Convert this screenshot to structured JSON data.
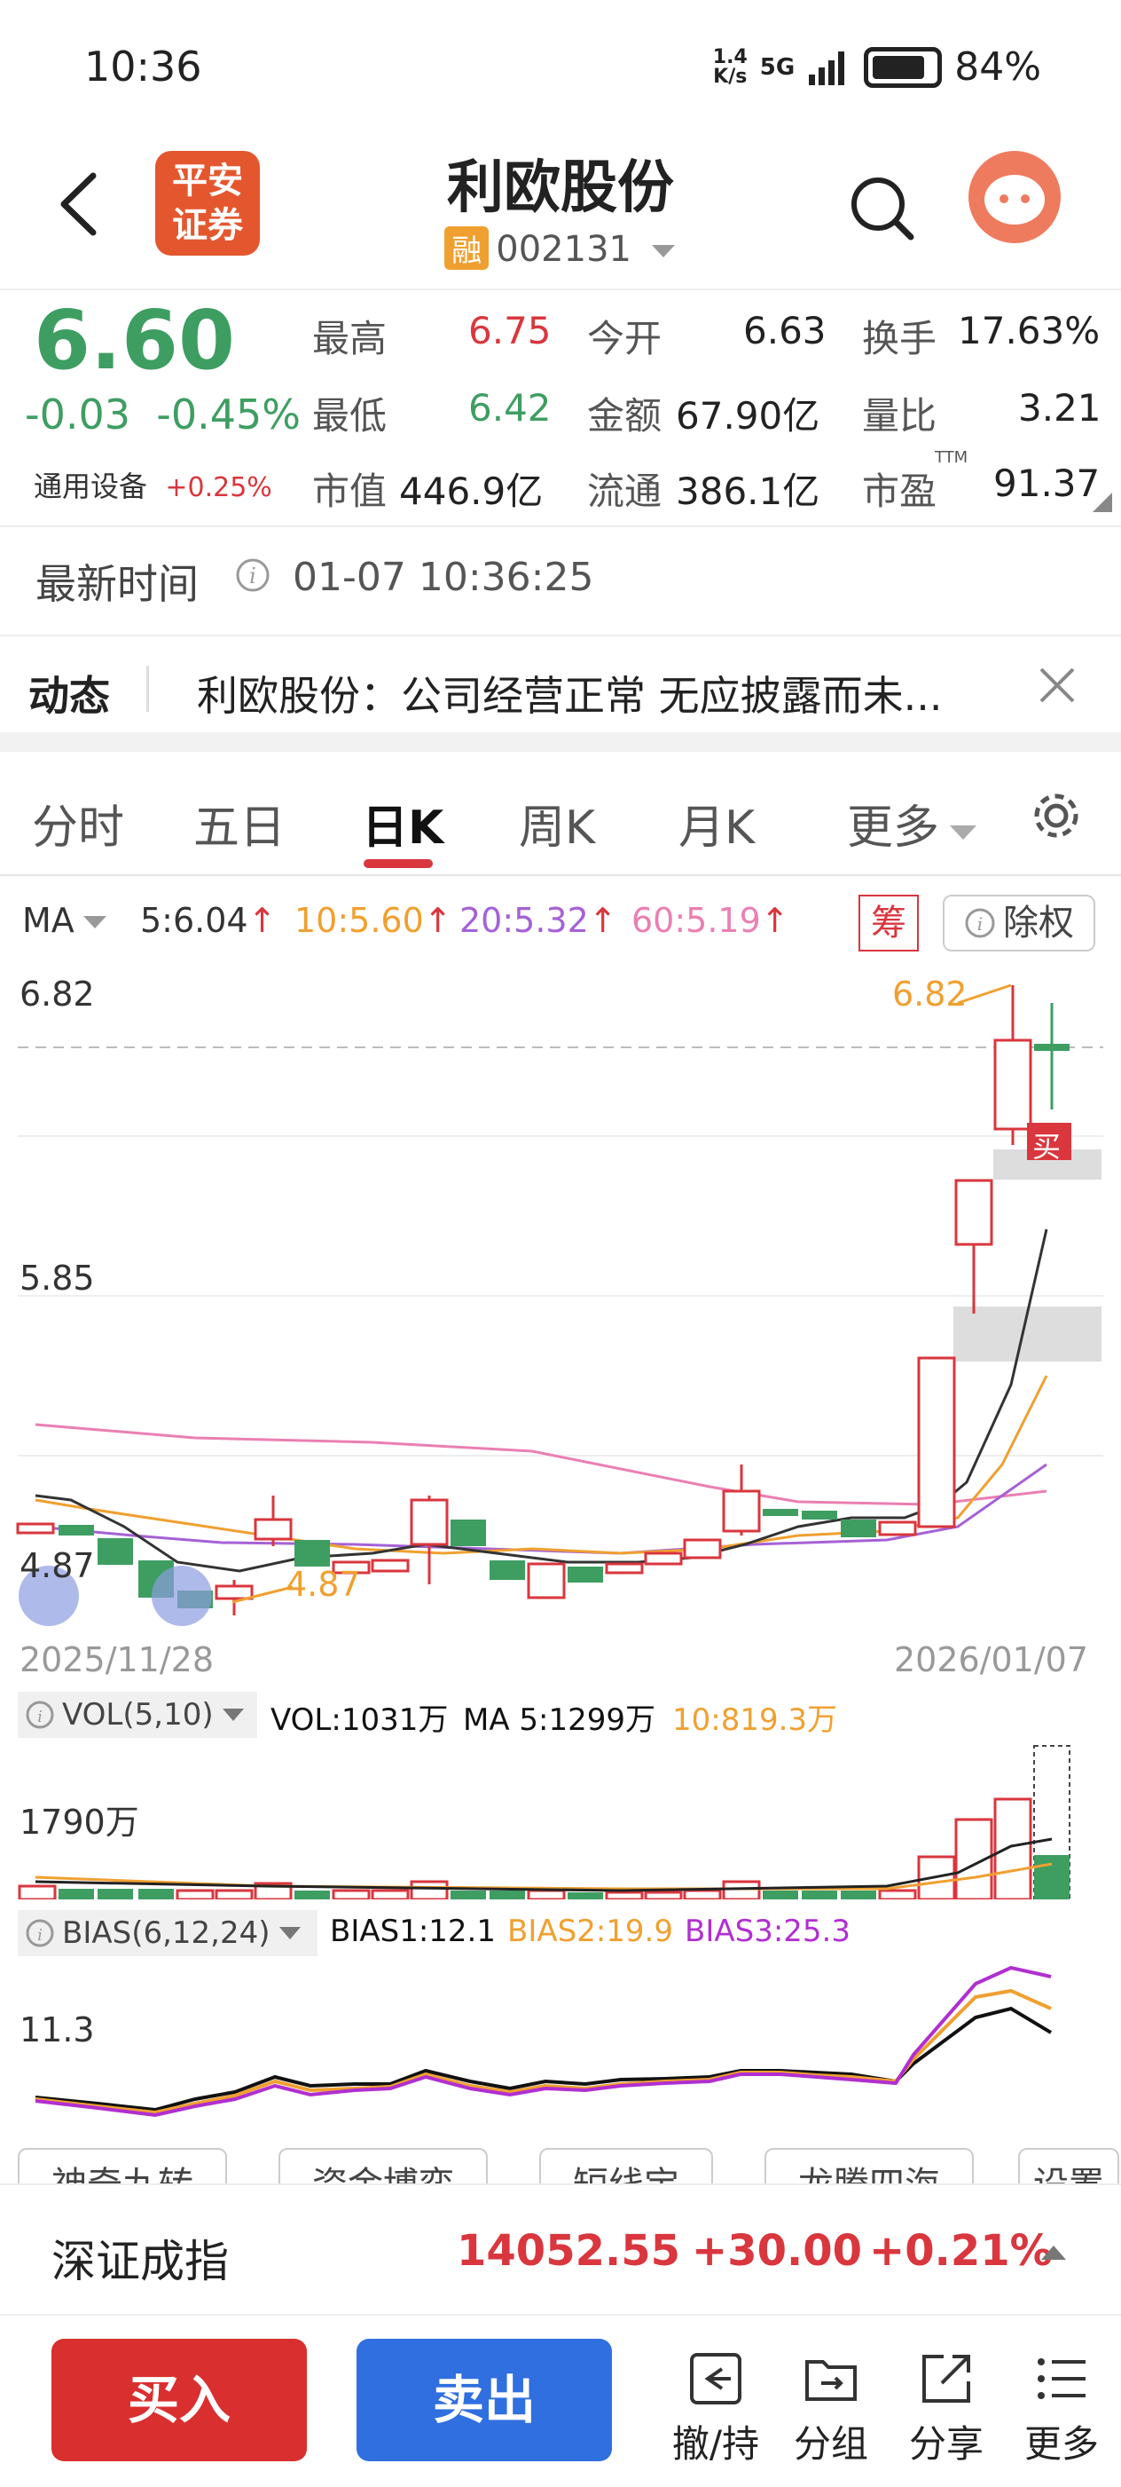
{
  "status_bar": {
    "time": "10:36",
    "speed_top": "1.4",
    "speed_bottom": "K/s",
    "network": "5G",
    "battery": "84%"
  },
  "header": {
    "logo_line1": "平安",
    "logo_line2": "证券",
    "title": "利欧股份",
    "rong": "融",
    "code": "002131"
  },
  "quote": {
    "price": "6.60",
    "change": "-0.03",
    "change_pct": "-0.45%",
    "sector_name": "通用设备",
    "sector_pct": "+0.25%",
    "high_label": "最高",
    "high": "6.75",
    "low_label": "最低",
    "low": "6.42",
    "mcap_label": "市值",
    "mcap": "446.9亿",
    "open_label": "今开",
    "open": "6.63",
    "amount_label": "金额",
    "amount": "67.90亿",
    "float_label": "流通",
    "float": "386.1亿",
    "turnover_label": "换手",
    "turnover": "17.63%",
    "vol_ratio_label": "量比",
    "vol_ratio": "3.21",
    "pe_label": "市盈",
    "pe_sup": "TTM",
    "pe": "91.37"
  },
  "timeline": {
    "label": "最新时间",
    "value": "01-07 10:36:25"
  },
  "news": {
    "tag": "动态",
    "text": "利欧股份：公司经营正常 无应披露而未..."
  },
  "tabs": [
    "分时",
    "五日",
    "日K",
    "周K",
    "月K",
    "更多"
  ],
  "ma": {
    "label": "MA",
    "ma5": "5:6.04",
    "ma10": "10:5.60",
    "ma20": "20:5.32",
    "ma60": "60:5.19",
    "chip": "筹",
    "fuquan": "除权"
  },
  "kchart": {
    "top_label": "6.82",
    "mid_label": "5.85",
    "low_label": "4.87",
    "high_mark": "6.82",
    "low_mark": "4.87",
    "buy_mark": "买",
    "date_start": "2025/11/28",
    "date_end": "2026/01/07"
  },
  "vol": {
    "selector": "VOL(5,10)",
    "vol": "VOL:1031万",
    "ma5": "MA 5:1299万",
    "ma10": "10:819.3万",
    "axis": "1790万"
  },
  "bias": {
    "selector": "BIAS(6,12,24)",
    "b1": "BIAS1:12.1",
    "b2": "BIAS2:19.9",
    "b3": "BIAS3:25.3",
    "axis": "11.3"
  },
  "indicators": [
    "神奇九转",
    "资金博弈",
    "短线宝",
    "龙腾四海",
    "设置"
  ],
  "index": {
    "name": "深证成指",
    "value": "14052.55",
    "change": "+30.00",
    "pct": "+0.21%"
  },
  "actions": {
    "buy": "买入",
    "sell": "卖出",
    "t1": "撤/持",
    "t2": "分组",
    "t3": "分享",
    "t4": "更多"
  },
  "colors": {
    "up": "#d9363e",
    "down": "#3e9e62",
    "ma5": "#333333",
    "ma10": "#f0a030",
    "ma20": "#a561d6",
    "ma60": "#ea7fb2",
    "buy": "#d9302f",
    "sell": "#2f6fe0"
  }
}
